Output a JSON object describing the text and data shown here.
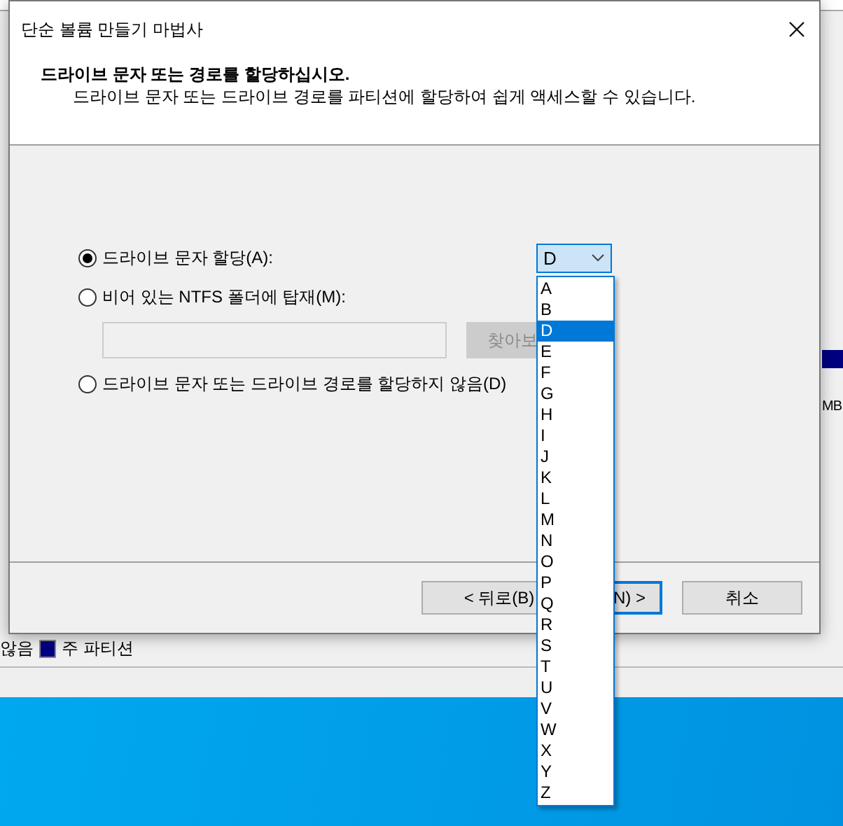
{
  "dialog": {
    "title": "단순 볼륨 만들기 마법사",
    "heading": "드라이브 문자 또는 경로를 할당하십시오.",
    "subheading": "드라이브 문자 또는 드라이브 경로를 파티션에 할당하여 쉽게 액세스할 수 있습니다."
  },
  "options": [
    {
      "label": "드라이브 문자 할당(A):",
      "selected": true
    },
    {
      "label": "비어 있는 NTFS 폴더에 탑재(M):",
      "selected": false
    },
    {
      "label": "드라이브 문자 또는 드라이브 경로를 할당하지 않음(D)",
      "selected": false
    }
  ],
  "drive_letter": {
    "value": "D",
    "expanded": true,
    "options": [
      {
        "label": "A",
        "selected": false
      },
      {
        "label": "B",
        "selected": false
      },
      {
        "label": "D",
        "selected": true
      },
      {
        "label": "E",
        "selected": false
      },
      {
        "label": "F",
        "selected": false
      },
      {
        "label": "G",
        "selected": false
      },
      {
        "label": "H",
        "selected": false
      },
      {
        "label": "I",
        "selected": false
      },
      {
        "label": "J",
        "selected": false
      },
      {
        "label": "K",
        "selected": false
      },
      {
        "label": "L",
        "selected": false
      },
      {
        "label": "M",
        "selected": false
      },
      {
        "label": "N",
        "selected": false
      },
      {
        "label": "O",
        "selected": false
      },
      {
        "label": "P",
        "selected": false
      },
      {
        "label": "Q",
        "selected": false
      },
      {
        "label": "R",
        "selected": false
      },
      {
        "label": "S",
        "selected": false
      },
      {
        "label": "T",
        "selected": false
      },
      {
        "label": "U",
        "selected": false
      },
      {
        "label": "V",
        "selected": false
      },
      {
        "label": "W",
        "selected": false
      },
      {
        "label": "X",
        "selected": false
      },
      {
        "label": "Y",
        "selected": false
      },
      {
        "label": "Z",
        "selected": false
      }
    ]
  },
  "browse_button": {
    "label": "찾아보",
    "disabled": true
  },
  "buttons": [
    {
      "label": "< 뒤로(B)",
      "kind": "back"
    },
    {
      "label": "N) >",
      "kind": "next"
    },
    {
      "label": "취소",
      "kind": "cancel"
    }
  ],
  "background": {
    "legend": [
      {
        "label": "않음"
      },
      {
        "label": "주 파티션",
        "color": "#000080"
      }
    ],
    "size_fragment": "MB"
  }
}
